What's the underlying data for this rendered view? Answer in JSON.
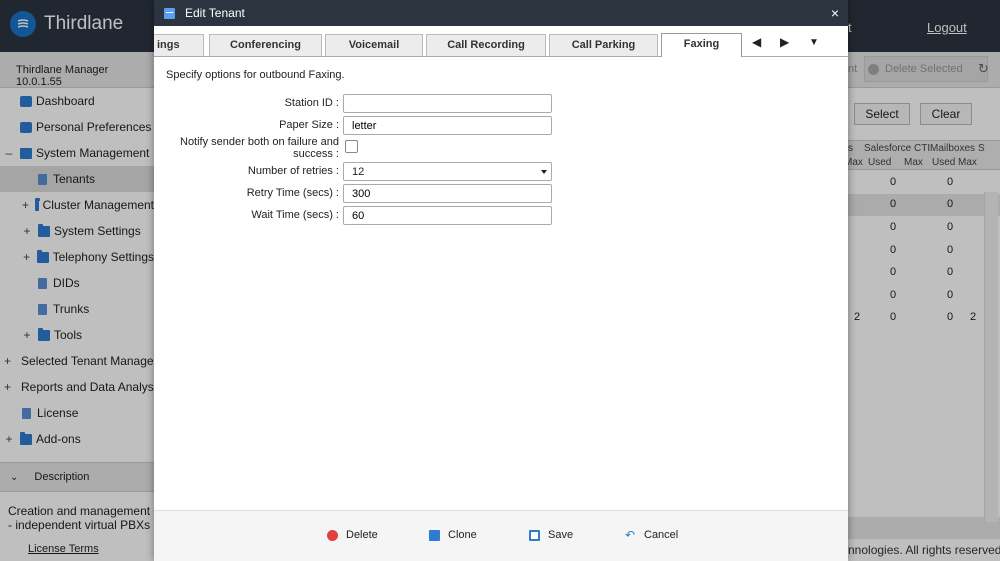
{
  "app": {
    "brand_name": "Thirdlane",
    "topbar_partial_text": "t",
    "logout_label": "Logout"
  },
  "sidebar": {
    "header": "Thirdlane Manager 10.0.1.55",
    "items": [
      {
        "label": "Dashboard",
        "expander": "",
        "icon": "dashboard-icon"
      },
      {
        "label": "Personal Preferences",
        "expander": "",
        "icon": "wrench-icon"
      },
      {
        "label": "System Management",
        "expander": "–",
        "icon": "monitor-icon"
      },
      {
        "label": "Tenants",
        "expander": "",
        "icon": "document-icon"
      },
      {
        "label": "Cluster Management",
        "expander": "+",
        "icon": "folder-icon"
      },
      {
        "label": "System Settings",
        "expander": "+",
        "icon": "folder-icon"
      },
      {
        "label": "Telephony Settings",
        "expander": "+",
        "icon": "folder-icon"
      },
      {
        "label": "DIDs",
        "expander": "",
        "icon": "document-icon"
      },
      {
        "label": "Trunks",
        "expander": "",
        "icon": "document-icon"
      },
      {
        "label": "Tools",
        "expander": "+",
        "icon": "folder-icon"
      },
      {
        "label": "Selected Tenant Management",
        "expander": "+",
        "icon": "tenant-icon"
      },
      {
        "label": "Reports and Data Analysis",
        "expander": "+",
        "icon": "reports-icon"
      },
      {
        "label": "License",
        "expander": "",
        "icon": "document-icon"
      },
      {
        "label": "Add-ons",
        "expander": "+",
        "icon": "folder-icon"
      }
    ],
    "description_title": "Description",
    "description_text_1": "Creation and management of",
    "description_text_2": "- independent virtual PBXs",
    "license_link": "License Terms"
  },
  "right_panel": {
    "toolbar_partial": "nt",
    "delete_selected_label": "Delete Selected",
    "refresh_icon": "refresh-icon",
    "select_label": "Select",
    "clear_label": "Clear",
    "grid_headers_top": [
      "s",
      "Salesforce CTI",
      "Mailboxes",
      "S"
    ],
    "grid_headers_bottom": [
      "Max",
      "Used",
      "Max",
      "Used",
      "Max"
    ],
    "rows": [
      {
        "col1": "",
        "col2": "0",
        "col3": "",
        "col4": "0",
        "col5": ""
      },
      {
        "col1": "",
        "col2": "0",
        "col3": "",
        "col4": "0",
        "col5": ""
      },
      {
        "col1": "",
        "col2": "0",
        "col3": "",
        "col4": "0",
        "col5": ""
      },
      {
        "col1": "",
        "col2": "0",
        "col3": "",
        "col4": "0",
        "col5": ""
      },
      {
        "col1": "",
        "col2": "0",
        "col3": "",
        "col4": "0",
        "col5": ""
      },
      {
        "col1": "",
        "col2": "0",
        "col3": "",
        "col4": "0",
        "col5": ""
      },
      {
        "col1": "2",
        "col2": "0",
        "col3": "",
        "col4": "0",
        "col5": "2"
      }
    ],
    "copyright": "nnologies. All rights reserved."
  },
  "modal": {
    "title": "Edit Tenant",
    "close_label": "×",
    "tabs": [
      {
        "label": "ings",
        "active": false
      },
      {
        "label": "Conferencing",
        "active": false
      },
      {
        "label": "Voicemail",
        "active": false
      },
      {
        "label": "Call Recording",
        "active": false
      },
      {
        "label": "Call Parking",
        "active": false
      },
      {
        "label": "Faxing",
        "active": true
      }
    ],
    "tab_nav": {
      "prev": "◀",
      "next": "▶",
      "more": "▼"
    },
    "description": "Specify options for outbound Faxing.",
    "fields": {
      "station_id": {
        "label": "Station ID :",
        "value": ""
      },
      "paper_size": {
        "label": "Paper Size :",
        "value": "letter"
      },
      "notify": {
        "label_1": "Notify sender both on failure and",
        "label_2": "success :",
        "checked": false
      },
      "retries": {
        "label": "Number of retries :",
        "value": "12"
      },
      "retry_time": {
        "label": "Retry Time (secs) :",
        "value": "300"
      },
      "wait_time": {
        "label": "Wait Time (secs) :",
        "value": "60"
      }
    },
    "footer": {
      "delete_label": "Delete",
      "clone_label": "Clone",
      "save_label": "Save",
      "cancel_label": "Cancel"
    }
  },
  "colors": {
    "topbar": "#2c3440",
    "accent": "#1a73c8",
    "delete_red": "#e04040",
    "save_blue": "#2e7bd0"
  }
}
